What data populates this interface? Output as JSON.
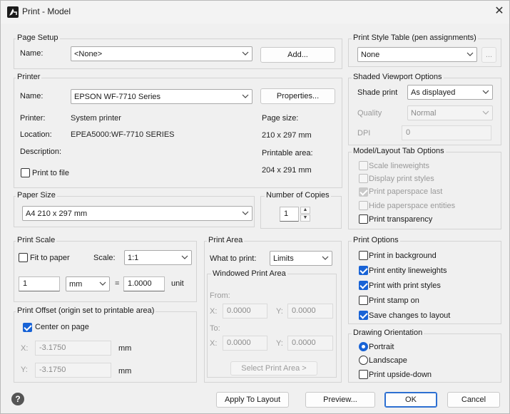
{
  "window": {
    "title": "Print - Model",
    "close_glyph": "✕"
  },
  "page_setup": {
    "group_label": "Page Setup",
    "name_label": "Name:",
    "name_value": "<None>",
    "add_button": "Add..."
  },
  "printer": {
    "group_label": "Printer",
    "name_label": "Name:",
    "name_value": "EPSON WF-7710 Series",
    "properties_button": "Properties...",
    "printer_label": "Printer:",
    "printer_value": "System printer",
    "location_label": "Location:",
    "location_value": "EPEA5000:WF-7710 SERIES",
    "description_label": "Description:",
    "page_size_label": "Page size:",
    "page_size_value": "210 x 297 mm",
    "printable_area_label": "Printable area:",
    "printable_area_value": "204 x 291 mm",
    "print_to_file_label": "Print to file"
  },
  "paper_size": {
    "group_label": "Paper Size",
    "value": "A4 210 x 297 mm"
  },
  "copies": {
    "group_label": "Number of Copies",
    "value": "1",
    "up_glyph": "▲",
    "down_glyph": "▼"
  },
  "print_scale": {
    "group_label": "Print Scale",
    "fit_label": "Fit to paper",
    "scale_label": "Scale:",
    "scale_value": "1:1",
    "value_left": "1",
    "units_value": "mm",
    "equals": "=",
    "value_right": "1.0000",
    "unit_label": "unit"
  },
  "print_offset": {
    "group_label": "Print Offset (origin set to printable area)",
    "center_label": "Center on page",
    "x_label": "X:",
    "x_value": "-3.1750",
    "x_unit": "mm",
    "y_label": "Y:",
    "y_value": "-3.1750",
    "y_unit": "mm"
  },
  "print_area": {
    "group_label": "Print Area",
    "what_label": "What to print:",
    "what_value": "Limits",
    "windowed_label": "Windowed Print Area",
    "from_label": "From:",
    "to_label": "To:",
    "from_x_label": "X:",
    "from_x_value": "0.0000",
    "from_y_label": "Y:",
    "from_y_value": "0.0000",
    "to_x_label": "X:",
    "to_x_value": "0.0000",
    "to_y_label": "Y:",
    "to_y_value": "0.0000",
    "select_button": "Select Print Area >"
  },
  "style_table": {
    "group_label": "Print Style Table (pen assignments)",
    "value": "None",
    "edit_button": "..."
  },
  "shaded": {
    "group_label": "Shaded Viewport Options",
    "shade_label": "Shade print",
    "shade_value": "As displayed",
    "quality_label": "Quality",
    "quality_value": "Normal",
    "dpi_label": "DPI",
    "dpi_value": "0"
  },
  "model_layout": {
    "group_label": "Model/Layout Tab Options",
    "items": [
      "Scale lineweights",
      "Display print styles",
      "Print paperspace last",
      "Hide paperspace entities",
      "Print transparency"
    ]
  },
  "print_options": {
    "group_label": "Print Options",
    "items": [
      "Print in background",
      "Print entity lineweights",
      "Print with print styles",
      "Print stamp on",
      "Save changes to layout"
    ]
  },
  "orientation": {
    "group_label": "Drawing Orientation",
    "portrait_label": "Portrait",
    "landscape_label": "Landscape",
    "upside_label": "Print upside-down"
  },
  "footer": {
    "help_glyph": "?",
    "apply_button": "Apply To Layout",
    "preview_button": "Preview...",
    "ok_button": "OK",
    "cancel_button": "Cancel"
  }
}
